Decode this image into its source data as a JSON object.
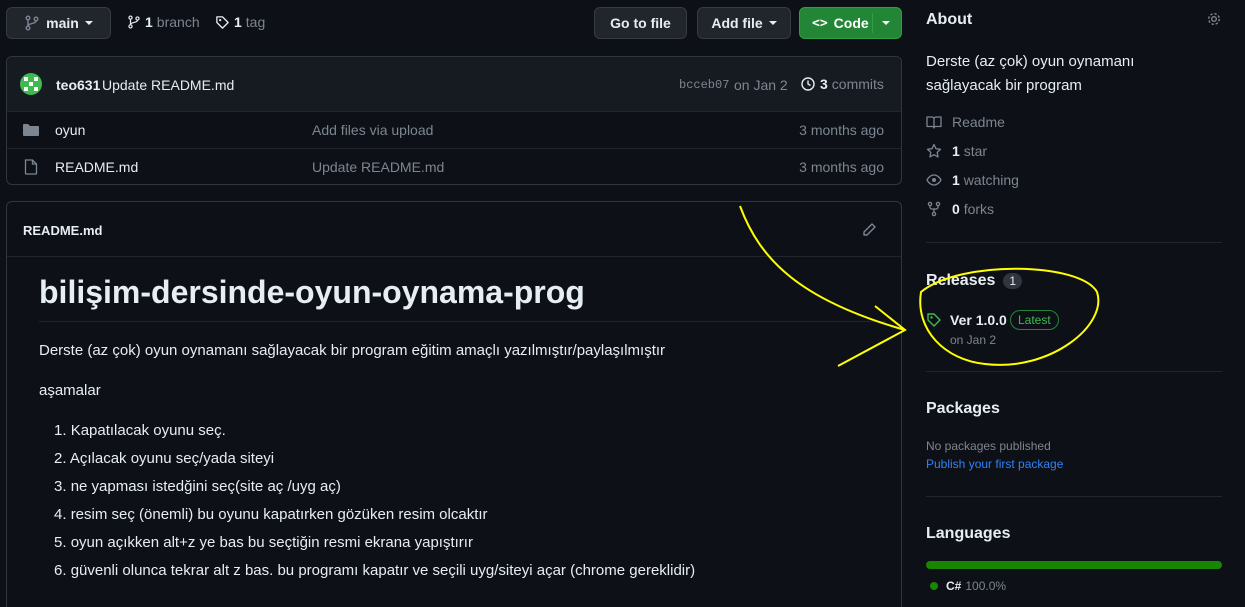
{
  "branch_bar": {
    "branch_name": "main",
    "branch_count": "1",
    "branch_label": "branch",
    "tag_count": "1",
    "tag_label": "tag",
    "go_to_file": "Go to file",
    "add_file": "Add file",
    "code": "Code"
  },
  "commit": {
    "author": "teo631",
    "message": "Update README.md",
    "hash": "bcceb07",
    "date": "on Jan 2",
    "count": "3",
    "count_label": "commits"
  },
  "files": [
    {
      "name": "oyun",
      "type": "folder",
      "message": "Add files via upload",
      "age": "3 months ago"
    },
    {
      "name": "README.md",
      "type": "file",
      "message": "Update README.md",
      "age": "3 months ago"
    }
  ],
  "readme": {
    "header": "README.md",
    "title": "bilişim-dersinde-oyun-oynama-prog",
    "intro": "Derste (az çok) oyun oynamanı sağlayacak bir program eğitim amaçlı yazılmıştır/paylaşılmıştır",
    "stages_label": "aşamalar",
    "steps": [
      "Kapatılacak oyunu seç.",
      "Açılacak oyunu seç/yada siteyi",
      "ne yapması istedğini seç(site aç /uyg aç)",
      "resim seç (önemli) bu oyunu kapatırken gözüken resim olcaktır",
      "oyun açıkken alt+z ye bas bu seçtiğin resmi ekrana yapıştırır",
      "güvenli olunca tekrar alt z bas. bu programı kapatır ve seçili uyg/siteyi açar (chrome gereklidir)"
    ]
  },
  "about": {
    "heading": "About",
    "description": "Derste (az çok) oyun oynamanı sağlayacak bir program",
    "readme": "Readme",
    "stars_count": "1",
    "stars_label": "star",
    "watching_count": "1",
    "watching_label": "watching",
    "forks_count": "0",
    "forks_label": "forks"
  },
  "releases": {
    "heading": "Releases",
    "count": "1",
    "version": "Ver 1.0.0",
    "badge": "Latest",
    "date": "on Jan 2"
  },
  "packages": {
    "heading": "Packages",
    "none_text": "No packages published",
    "publish_link": "Publish your first package"
  },
  "languages": {
    "heading": "Languages",
    "items": [
      {
        "name": "C#",
        "percent": "100.0%",
        "color": "#178600",
        "share": 1.0
      }
    ]
  },
  "colors": {
    "accent_green": "#238636",
    "link_blue": "#2f81f7",
    "annotation_yellow": "#ffff00"
  }
}
